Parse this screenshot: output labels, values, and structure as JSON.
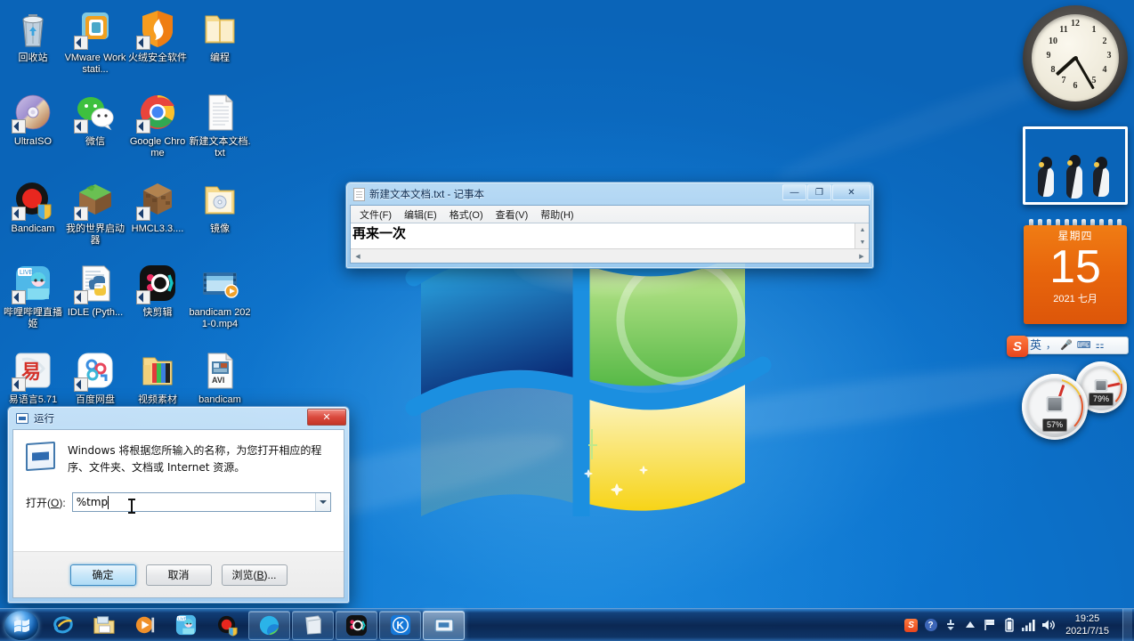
{
  "desktop": {
    "icons": [
      {
        "label": "回收站",
        "icon": "recycle-bin-icon",
        "shortcut": false
      },
      {
        "label": "VMware Workstati...",
        "icon": "vmware-icon",
        "shortcut": true
      },
      {
        "label": "火绒安全软件",
        "icon": "huorong-security-icon",
        "shortcut": true
      },
      {
        "label": "编程",
        "icon": "folder-icon",
        "shortcut": false
      },
      {
        "label": "UltraISO",
        "icon": "ultraiso-icon",
        "shortcut": true
      },
      {
        "label": "微信",
        "icon": "wechat-icon",
        "shortcut": true
      },
      {
        "label": "Google Chrome",
        "icon": "chrome-icon",
        "shortcut": true
      },
      {
        "label": "新建文本文档.txt",
        "icon": "text-file-icon",
        "shortcut": false
      },
      {
        "label": "Bandicam",
        "icon": "bandicam-icon",
        "shortcut": true
      },
      {
        "label": "我的世界启动器",
        "icon": "minecraft-launcher-icon",
        "shortcut": true
      },
      {
        "label": "HMCL3.3....",
        "icon": "hmcl-icon",
        "shortcut": true
      },
      {
        "label": "镜像",
        "icon": "folder-iso-icon",
        "shortcut": false
      },
      {
        "label": "哔哩哔哩直播姬",
        "icon": "bilibili-live-icon",
        "shortcut": true
      },
      {
        "label": "IDLE (Pyth...",
        "icon": "python-idle-icon",
        "shortcut": true
      },
      {
        "label": "快剪辑",
        "icon": "kuaijianji-icon",
        "shortcut": true
      },
      {
        "label": "bandicam 2021-0.mp4",
        "icon": "video-file-icon",
        "shortcut": false
      },
      {
        "label": "易语言5.71",
        "icon": "eyuyan-icon",
        "shortcut": true
      },
      {
        "label": "百度网盘",
        "icon": "baidu-netdisk-icon",
        "shortcut": true
      },
      {
        "label": "视频素材",
        "icon": "folder-media-icon",
        "shortcut": false
      },
      {
        "label": "bandicam",
        "icon": "avi-file-icon",
        "shortcut": false
      }
    ]
  },
  "notepad": {
    "title": "新建文本文档.txt - 记事本",
    "menus": [
      "文件(F)",
      "编辑(E)",
      "格式(O)",
      "查看(V)",
      "帮助(H)"
    ],
    "content": "再来一次",
    "buttons": {
      "minimize": "—",
      "maximize": "❐",
      "close": "✕"
    }
  },
  "run_dialog": {
    "title": "运行",
    "close_label": "✕",
    "description": "Windows 将根据您所输入的名称，为您打开相应的程序、文件夹、文档或 Internet 资源。",
    "open_label": "打开(O):",
    "open_label_prefix": "打开(",
    "open_label_key": "O",
    "open_label_suffix": "):",
    "input_value": "%tmp",
    "input_placeholder": "",
    "buttons": {
      "ok": "确定",
      "cancel": "取消",
      "browse_prefix": "浏览(",
      "browse_key": "B",
      "browse_suffix": ")..."
    }
  },
  "gadgets": {
    "clock": {
      "name": "clock-gadget",
      "hour_hand_deg": 228,
      "minute_hand_deg": 150,
      "numerals": [
        "12",
        "1",
        "2",
        "3",
        "4",
        "5",
        "6",
        "7",
        "8",
        "9",
        "10",
        "11"
      ]
    },
    "picture": {
      "name": "picture-gadget",
      "caption": "penguins-photo"
    },
    "calendar": {
      "weekday": "星期四",
      "day": "15",
      "month": "2021 七月"
    },
    "ime": {
      "logo": "S",
      "mode": "英",
      "items": [
        "，",
        "🎤",
        "⌨",
        "⚏"
      ]
    },
    "meter": {
      "cpu_label": "57%",
      "cpu_value": 57,
      "memory_label": "79%",
      "memory_value": 79
    }
  },
  "taskbar": {
    "start_label": "start-orb",
    "pinned": [
      {
        "name": "internet-explorer-icon",
        "label": "Internet Explorer"
      },
      {
        "name": "windows-explorer-icon",
        "label": "Windows 资源管理器"
      },
      {
        "name": "windows-media-player-icon",
        "label": "Windows Media Player"
      },
      {
        "name": "bilibili-live-icon",
        "label": "哔哩哔哩直播姬"
      },
      {
        "name": "bandicam-icon",
        "label": "Bandicam"
      }
    ],
    "windows": [
      {
        "name": "edge-icon",
        "label": "Microsoft Edge",
        "active": false
      },
      {
        "name": "notepad-icon",
        "label": "记事本",
        "active": false
      },
      {
        "name": "kuaijianji-icon",
        "label": "快剪辑",
        "active": false
      },
      {
        "name": "kugou-icon",
        "label": "K",
        "active": false
      },
      {
        "name": "run-dialog-icon",
        "label": "运行",
        "active": true
      }
    ],
    "tray": [
      {
        "name": "sogou-ime-tray-icon",
        "glyph": "S"
      },
      {
        "name": "help-tray-icon",
        "glyph": "?"
      },
      {
        "name": "show-hidden-icons-icon",
        "glyph": "▲"
      },
      {
        "name": "network-flag-icon",
        "glyph": "⚑"
      },
      {
        "name": "battery-icon",
        "glyph": "▯"
      },
      {
        "name": "wireless-signal-icon",
        "glyph": "▮"
      },
      {
        "name": "volume-icon",
        "glyph": "🔊"
      }
    ],
    "clock": {
      "time": "19:25",
      "date": "2021/7/15"
    }
  },
  "colors": {
    "desktop_blue": "#0d7ad6",
    "taskbar_blue": "#0a224a",
    "calendar_orange": "#e7650c",
    "accent": "#3c8bc4"
  }
}
